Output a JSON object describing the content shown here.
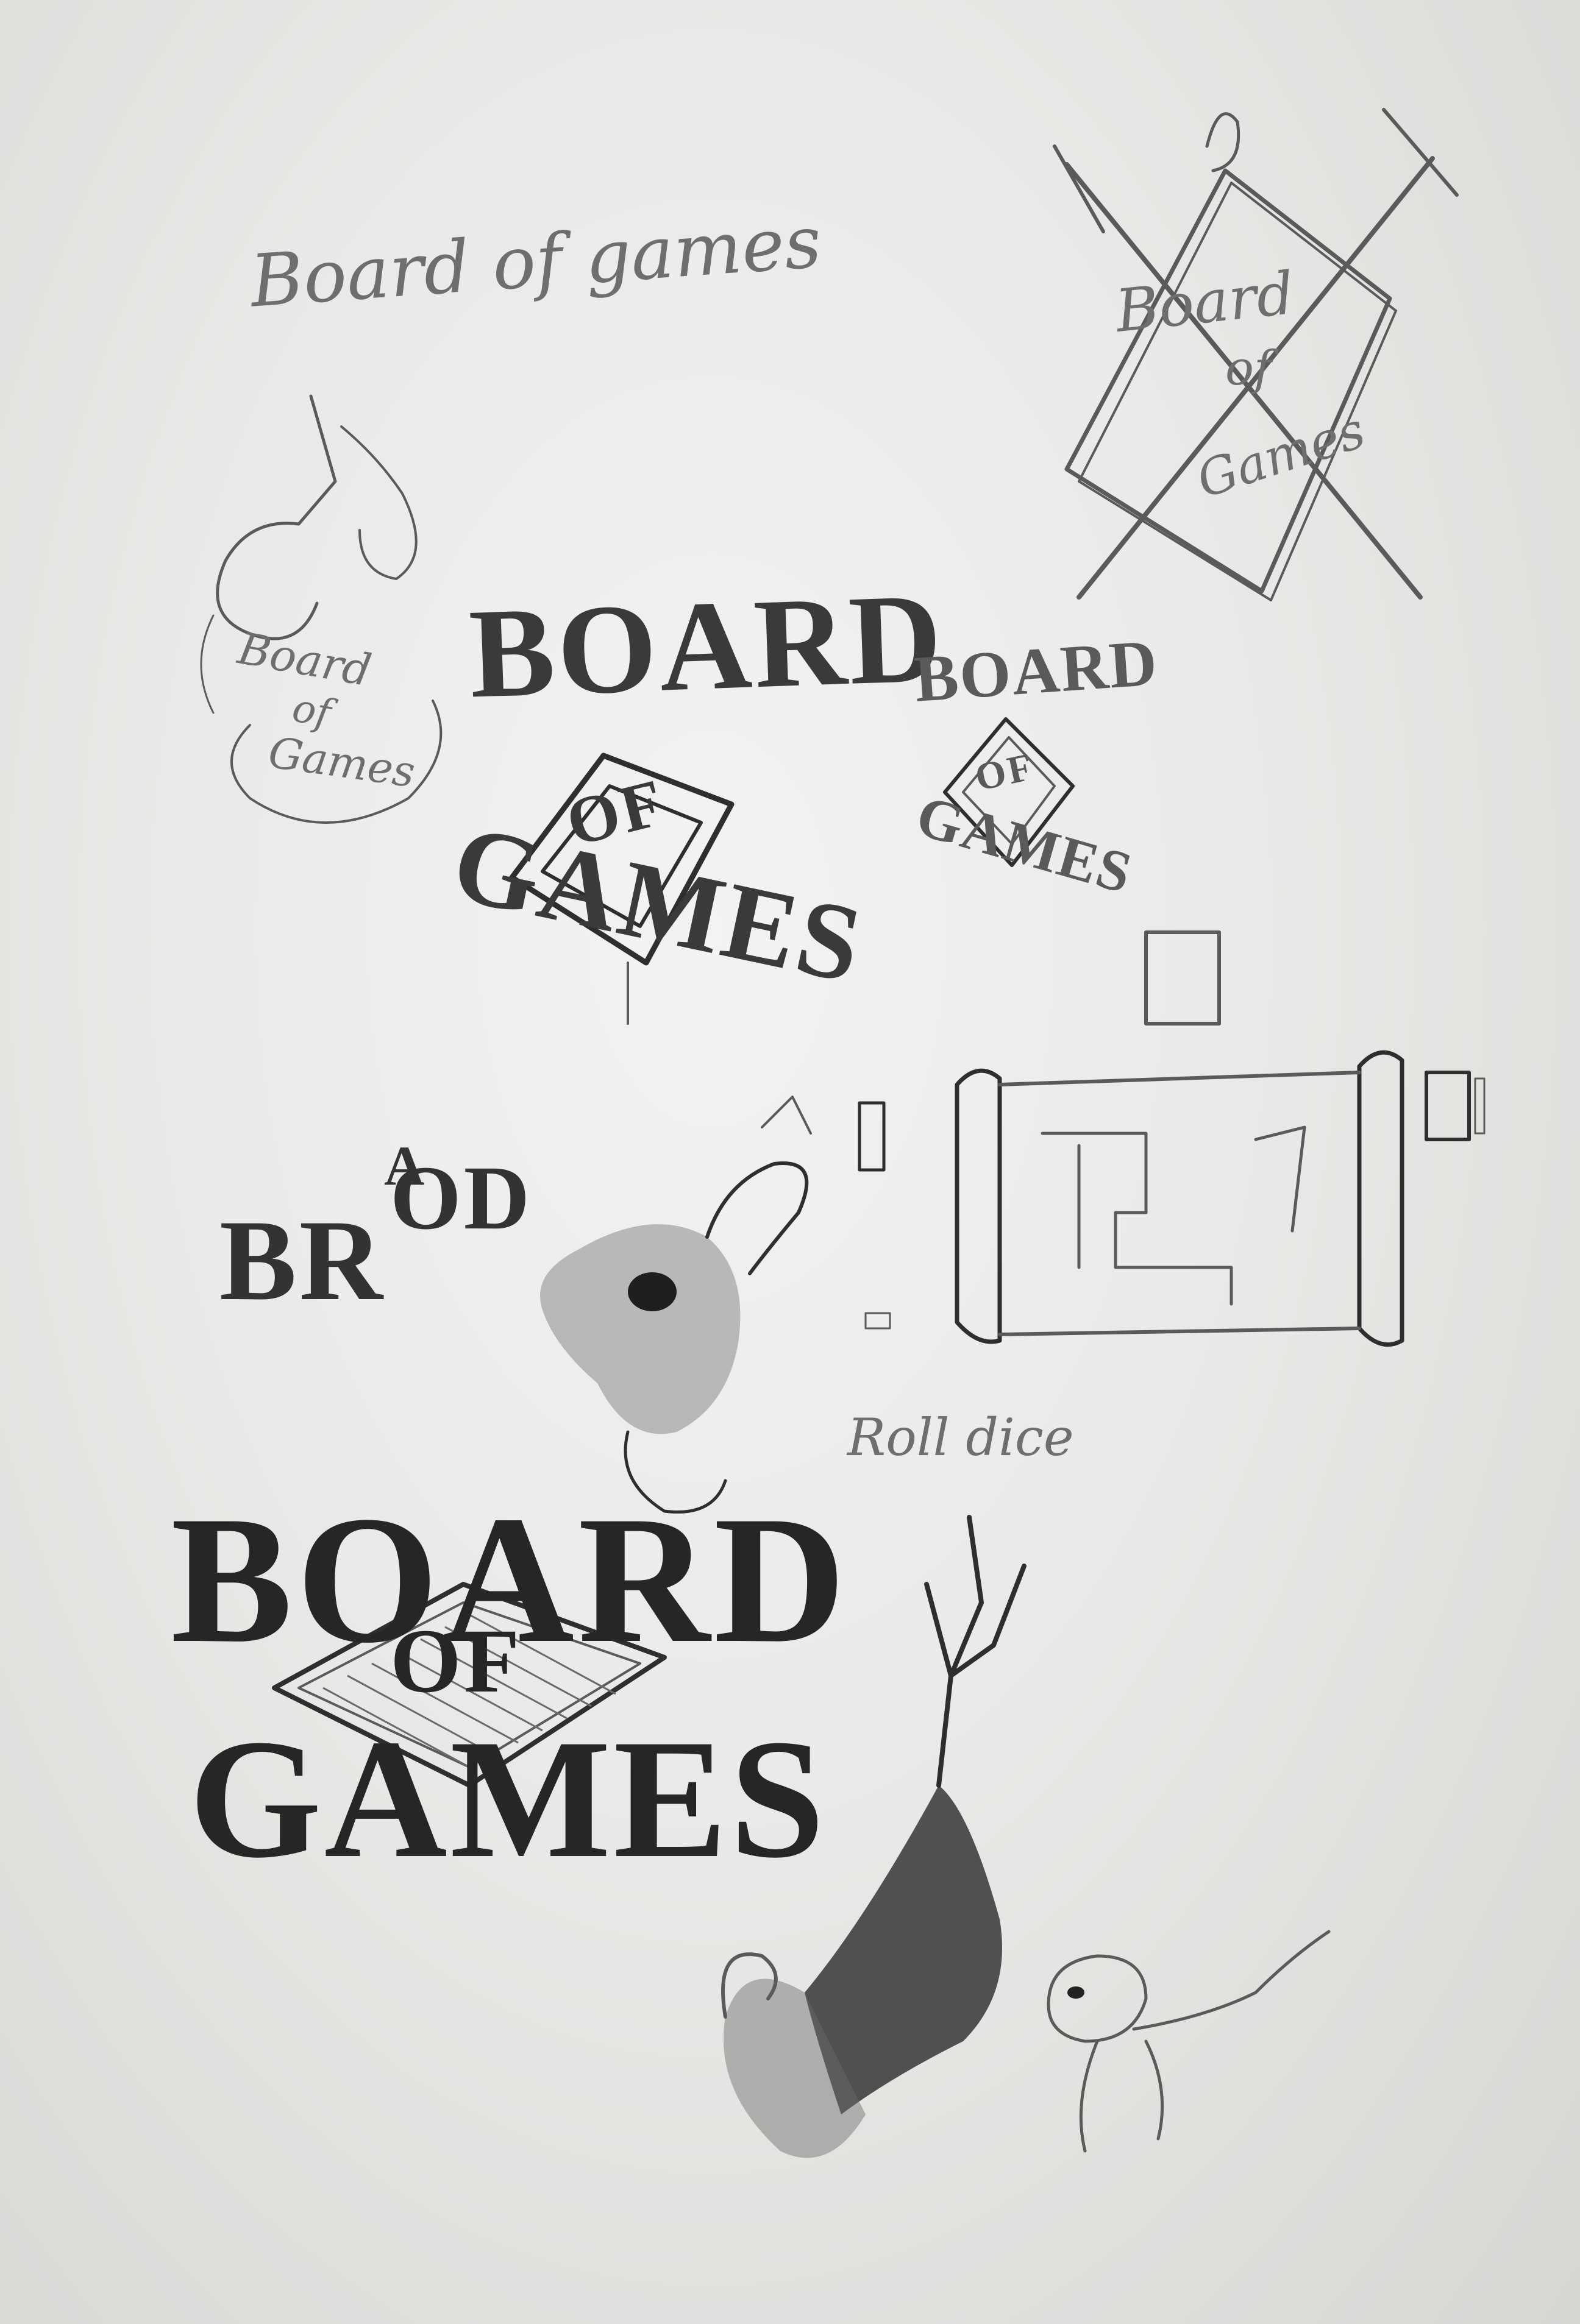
{
  "sketches": {
    "script_title": "Board of games",
    "crossed_swords": {
      "line1": "Board",
      "line2": "of",
      "line3": "Games"
    },
    "dragon_scroll": {
      "line1": "Board",
      "line2": "of",
      "line3": "Games"
    },
    "diamond_logo_large": {
      "top": "BOARD",
      "middle": "OF",
      "bottom": "GAMES"
    },
    "diamond_logo_small": {
      "top": "BOARD",
      "middle": "OF",
      "bottom": "GAMES"
    },
    "brod": {
      "text": "BR",
      "a": "A",
      "od": "OD"
    },
    "roll_dice": "Roll dice",
    "final_logo": {
      "top": "BOARD",
      "middle": "OF",
      "bottom": "GAMES"
    }
  }
}
